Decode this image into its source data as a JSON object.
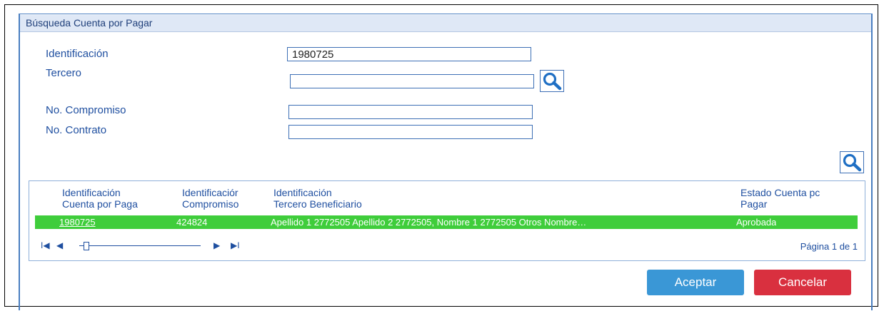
{
  "dialog": {
    "title": "Búsqueda Cuenta por Pagar"
  },
  "form": {
    "identificacion": {
      "label": "Identificación",
      "value": "1980725"
    },
    "tercero": {
      "label": "Tercero",
      "value": ""
    },
    "compromiso": {
      "label": "No. Compromiso",
      "value": ""
    },
    "contrato": {
      "label": "No. Contrato",
      "value": ""
    }
  },
  "grid": {
    "headers": {
      "col1": {
        "line1": "Identificación",
        "line2": "Cuenta por Paga"
      },
      "col2": {
        "line1": "Identificaciór",
        "line2": "Compromiso"
      },
      "col3": {
        "line1": "Identificación",
        "line2": "Tercero Beneficiario"
      },
      "col4": {
        "line1": "Estado Cuenta pc",
        "line2": "Pagar"
      }
    },
    "rows": [
      {
        "cuenta": "1980725",
        "compromiso": "424824",
        "tercero": "Apellido 1 2772505 Apellido 2 2772505, Nombre 1 2772505 Otros Nombre…",
        "estado": "Aprobada"
      }
    ],
    "pager": {
      "first": "I◀",
      "prev": "◀",
      "next": "▶",
      "last": "▶I",
      "page_text": "Página 1 de 1"
    }
  },
  "buttons": {
    "accept": "Aceptar",
    "cancel": "Cancelar"
  },
  "colors": {
    "accent": "#3d6fb5",
    "row_selected": "#3fcd3b",
    "accept": "#3a97d6",
    "cancel": "#d9303f"
  },
  "icons": {
    "search": "search-icon"
  }
}
